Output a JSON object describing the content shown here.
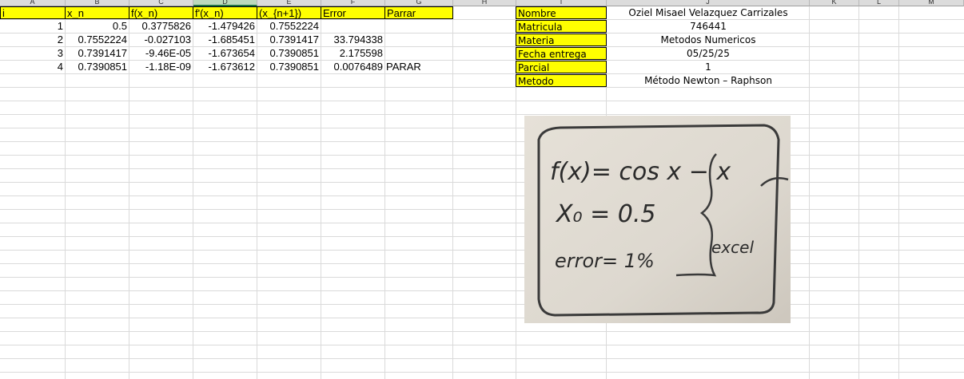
{
  "sheet": {
    "columns": [
      "A",
      "B",
      "C",
      "D",
      "E",
      "F",
      "G",
      "H",
      "I",
      "J",
      "K",
      "L",
      "M"
    ],
    "selected_column": "D",
    "headers": [
      "i",
      "x_n",
      "f(x_n)",
      "f'(x_n)",
      "(x_{n+1})",
      "Error",
      "Parrar"
    ],
    "rows": [
      {
        "i": "1",
        "x_n": "0.5",
        "fx": "0.3775826",
        "dfx": "-1.479426",
        "xn1": "0.7552224",
        "error": "",
        "parar": ""
      },
      {
        "i": "2",
        "x_n": "0.7552224",
        "fx": "-0.027103",
        "dfx": "-1.685451",
        "xn1": "0.7391417",
        "error": "33.794338",
        "parar": ""
      },
      {
        "i": "3",
        "x_n": "0.7391417",
        "fx": "-9.46E-05",
        "dfx": "-1.673654",
        "xn1": "0.7390851",
        "error": "2.175598",
        "parar": ""
      },
      {
        "i": "4",
        "x_n": "0.7390851",
        "fx": "-1.18E-09",
        "dfx": "-1.673612",
        "xn1": "0.7390851",
        "error": "0.0076489",
        "parar": "PARAR"
      }
    ],
    "info": [
      {
        "label": "Nombre",
        "value": "Oziel Misael Velazquez Carrizales"
      },
      {
        "label": "Matricula",
        "value": "746441"
      },
      {
        "label": "Materia",
        "value": "Metodos Numericos"
      },
      {
        "label": "Fecha entrega",
        "value": "05/25/25"
      },
      {
        "label": "Parcial",
        "value": "1"
      },
      {
        "label": "Metodo",
        "value": "Método Newton – Raphson"
      }
    ]
  },
  "photo": {
    "line1": "f(x)= cos x − x",
    "line2": "X₀ = 0.5",
    "line3": "error= 1%",
    "side_note": "excel"
  },
  "colors": {
    "header_fill": "#ffff00",
    "grid_line": "#dadada",
    "column_header": "#dcdcdc",
    "selected_header": "#bcd9bc"
  }
}
